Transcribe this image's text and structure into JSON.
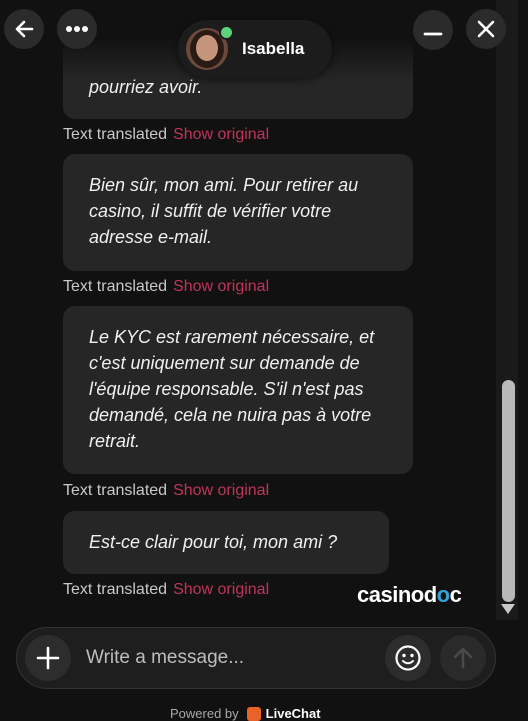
{
  "header": {
    "agent_name": "Isabella",
    "back_icon": "arrow-left-icon",
    "more_icon": "more-horizontal-icon",
    "minimize_icon": "minimize-icon",
    "close_icon": "close-icon",
    "online_color": "#5cd47a"
  },
  "messages": [
    {
      "text": "pourriez avoir.",
      "meta_label": "Text translated",
      "meta_link": "Show original"
    },
    {
      "text": "Bien sûr, mon ami. Pour retirer au casino, il suffit de vérifier votre adresse e-mail.",
      "meta_label": "Text translated",
      "meta_link": "Show original"
    },
    {
      "text": "Le KYC est rarement nécessaire, et c'est uniquement sur demande de l'équipe responsable. S'il n'est pas demandé, cela ne nuira pas à votre retrait.",
      "meta_label": "Text translated",
      "meta_link": "Show original"
    },
    {
      "text": "Est-ce clair pour toi, mon ami ?",
      "meta_label": "Text translated",
      "meta_link": "Show original"
    }
  ],
  "watermark": {
    "part1": "casinod",
    "part2": "o",
    "part3": "c"
  },
  "composer": {
    "placeholder": "Write a message...",
    "add_icon": "plus-icon",
    "emoji_icon": "emoji-icon",
    "send_icon": "send-arrow-up-icon"
  },
  "footer": {
    "powered_by": "Powered by",
    "brand": "LiveChat"
  },
  "colors": {
    "accent_link": "#c1345c",
    "bubble": "#262626",
    "background": "#111111"
  }
}
